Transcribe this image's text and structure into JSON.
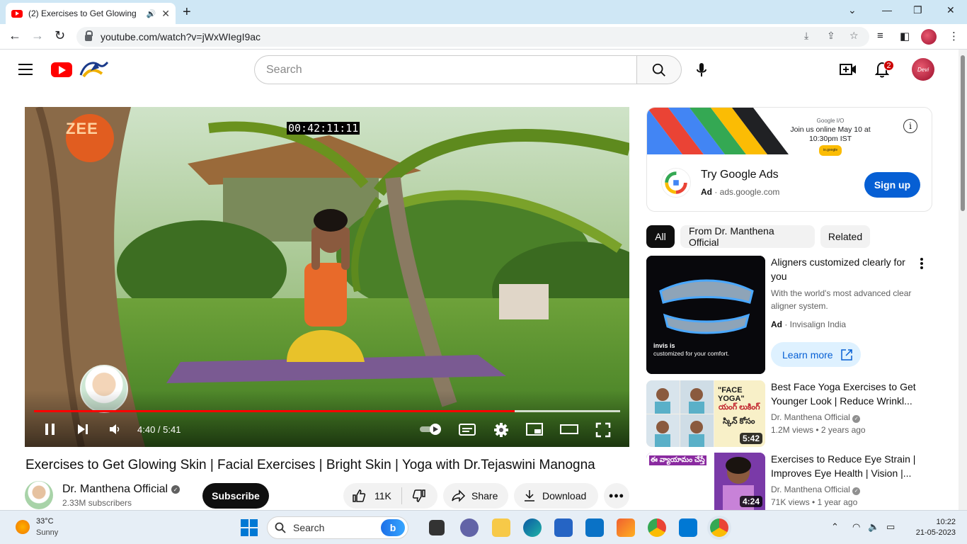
{
  "browser": {
    "tab_title": "(2) Exercises to Get Glowing",
    "url": "youtube.com/watch?v=jWxWIegI9ac",
    "new_tab": "+",
    "tab_close": "✕"
  },
  "header": {
    "search_placeholder": "Search",
    "notification_count": "2",
    "avatar_text": "Devi"
  },
  "player": {
    "timecode": "00:42:11:11",
    "time_display": "4:40 / 5:41",
    "progress_fraction": 0.82,
    "buffer_fraction": 1.0
  },
  "video": {
    "title": "Exercises to Get Glowing Skin | Facial Exercises | Bright Skin | Yoga with Dr.Tejaswini Manogna",
    "channel_name": "Dr. Manthena Official",
    "subscribers": "2.33M subscribers",
    "subscribe_label": "Subscribe",
    "like_count": "11K",
    "share_label": "Share",
    "download_label": "Download"
  },
  "sidebar_ad": {
    "banner_brand": "Google I/O",
    "banner_text": "Join us online May 10 at 10:30pm IST",
    "banner_pill": "io.google",
    "title": "Try Google Ads",
    "ad_label": "Ad",
    "domain": "ads.google.com",
    "cta": "Sign up"
  },
  "chips": [
    {
      "label": "All"
    },
    {
      "label": "From Dr. Manthena Official"
    },
    {
      "label": "Related"
    }
  ],
  "recommendations": [
    {
      "title": "Aligners customized clearly for you",
      "description": "With the world's most advanced clear aligner system.",
      "ad_label": "Ad",
      "advertiser": "Invisalign India",
      "cta": "Learn more",
      "thumb_caption_brand": "invis is",
      "thumb_caption": "customized for your comfort."
    },
    {
      "title": "Best Face Yoga Exercises to Get Younger Look | Reduce Wrinkl...",
      "channel": "Dr. Manthena Official",
      "meta": "1.2M views  • 2 years ago",
      "duration": "5:42",
      "thumb_label": "\"FACE YOGA\"",
      "thumb_telugu_1": "యంగ్ లుకింగ్",
      "thumb_telugu_2": "స్కిన్ కోసం"
    },
    {
      "title": "Exercises to Reduce Eye Strain | Improves Eye Health | Vision |...",
      "channel": "Dr. Manthena Official",
      "meta": "71K views  • 1 year ago",
      "duration": "4:24",
      "thumb_label": "ఈ వ్యాయామం చేస్తే"
    }
  ],
  "taskbar": {
    "temperature": "33°C",
    "weather": "Sunny",
    "search_label": "Search",
    "time": "10:22",
    "date": "21-05-2023"
  },
  "colors": {
    "youtube_red": "#ff0000",
    "subscribe_bg": "#0f0f0f",
    "signup_bg": "#065fd4",
    "chip_active": "#0f0f0f"
  }
}
